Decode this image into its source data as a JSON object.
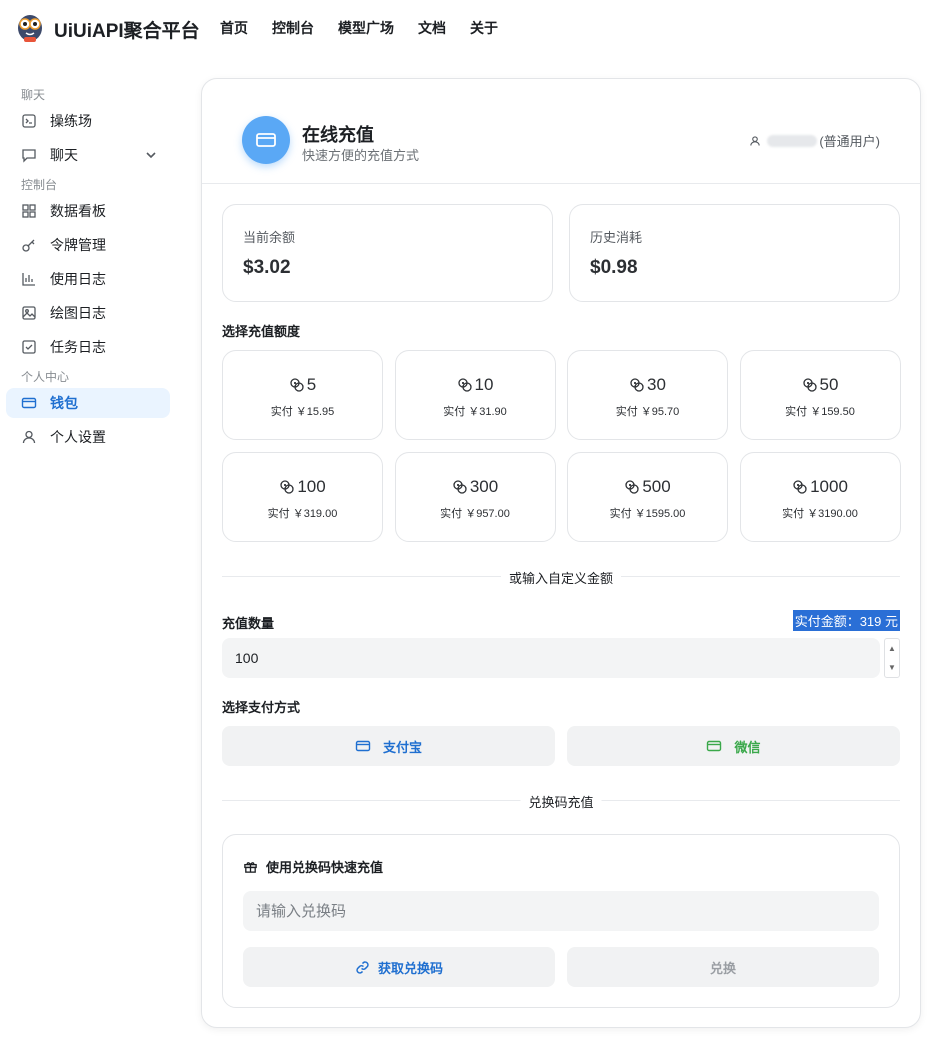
{
  "app": {
    "brand": "UiUiAPI聚合平台"
  },
  "topnav": [
    {
      "label": "首页"
    },
    {
      "label": "控制台"
    },
    {
      "label": "模型广场"
    },
    {
      "label": "文档"
    },
    {
      "label": "关于"
    }
  ],
  "sidebar": {
    "section_chat": "聊天",
    "item_playground": "操练场",
    "item_chat": "聊天",
    "section_console": "控制台",
    "item_dashboard": "数据看板",
    "item_tokens": "令牌管理",
    "item_usage": "使用日志",
    "item_drawing": "绘图日志",
    "item_tasks": "任务日志",
    "section_personal": "个人中心",
    "item_wallet": "钱包",
    "item_settings": "个人设置"
  },
  "header": {
    "title": "在线充值",
    "subtitle": "快速方便的充值方式",
    "user_role": "(普通用户)"
  },
  "stats": {
    "balance_label": "当前余额",
    "balance_value": "$3.02",
    "consumed_label": "历史消耗",
    "consumed_value": "$0.98"
  },
  "amounts": {
    "title": "选择充值额度",
    "items": [
      {
        "amount": "5",
        "pay": "实付 ￥15.95"
      },
      {
        "amount": "10",
        "pay": "实付 ￥31.90"
      },
      {
        "amount": "30",
        "pay": "实付 ￥95.70"
      },
      {
        "amount": "50",
        "pay": "实付 ￥159.50"
      },
      {
        "amount": "100",
        "pay": "实付 ￥319.00"
      },
      {
        "amount": "300",
        "pay": "实付 ￥957.00"
      },
      {
        "amount": "500",
        "pay": "实付 ￥1595.00"
      },
      {
        "amount": "1000",
        "pay": "实付 ￥3190.00"
      }
    ]
  },
  "custom": {
    "divider": "或输入自定义金额",
    "qty_label": "充值数量",
    "pay_total": "实付金额：319 元",
    "qty_value": "100"
  },
  "payment": {
    "title": "选择支付方式",
    "alipay": "支付宝",
    "wechat": "微信",
    "alipay_color": "#1f6fd0",
    "wechat_color": "#3aa84a"
  },
  "redeem": {
    "divider": "兑换码充值",
    "title": "使用兑换码快速充值",
    "placeholder": "请输入兑换码",
    "get_code": "获取兑换码",
    "redeem": "兑换"
  }
}
